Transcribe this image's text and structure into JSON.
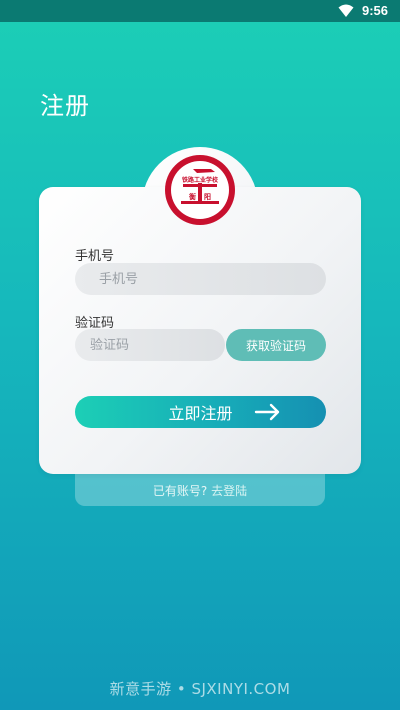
{
  "status_bar": {
    "time": "9:56",
    "icon": "wifi-icon"
  },
  "page": {
    "title": "注册"
  },
  "logo": {
    "text_top": "铁路工业学校",
    "text_bottom": "衡阳"
  },
  "form": {
    "phone_label": "手机号",
    "phone_placeholder": "手机号",
    "code_label": "验证码",
    "code_placeholder": "验证码",
    "get_code_button": "获取验证码",
    "submit_button": "立即注册"
  },
  "footer": {
    "prompt": "已有账号?",
    "login_link": "去登陆"
  },
  "watermark": "新意手游 • SJXINYI.COM",
  "colors": {
    "accent_start": "#1ccfb6",
    "accent_end": "#1590b2",
    "code_button": "#5fbdb6",
    "logo_red": "#c8102e"
  }
}
